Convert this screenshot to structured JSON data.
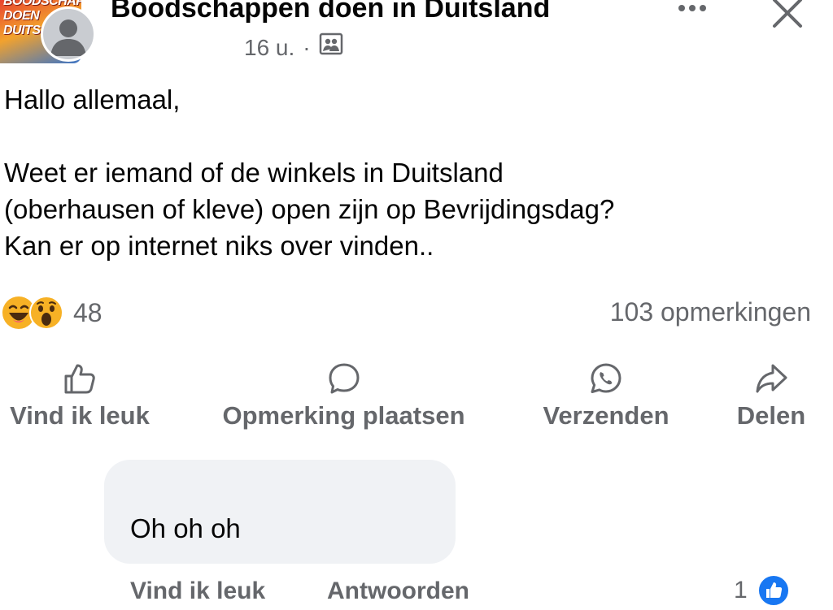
{
  "header": {
    "group_name": "Boodschappen doen in Duitsland",
    "logo_lines": [
      "BOODSCHAPPE",
      "DOEN",
      "DUITS"
    ],
    "time": "16 u.",
    "separator": "·",
    "audience_icon": "group-audience-icon",
    "more_icon": "more-dots-icon",
    "close_icon": "close-icon"
  },
  "post": {
    "text": "Hallo allemaal,\n\nWeet er iemand of de winkels in Duitsland\n(oberhausen of kleve) open zijn op Bevrijdingsdag?\nKan er op internet niks over vinden.."
  },
  "reactions": {
    "icons": [
      "haha-emoji",
      "wow-emoji"
    ],
    "count": "48",
    "comments": "103 opmerkingen"
  },
  "actions": {
    "like": "Vind ik leuk",
    "comment": "Opmerking plaatsen",
    "send": "Verzenden",
    "share": "Delen"
  },
  "comment": {
    "text": "Oh oh oh",
    "like_label": "Vind ik leuk",
    "reply_label": "Antwoorden",
    "like_count": "1"
  },
  "colors": {
    "text": "#050505",
    "secondary_text": "#65676b",
    "bubble": "#f0f2f5",
    "like_blue": "#1877f2",
    "emoji_yellow": "#f7b125"
  }
}
